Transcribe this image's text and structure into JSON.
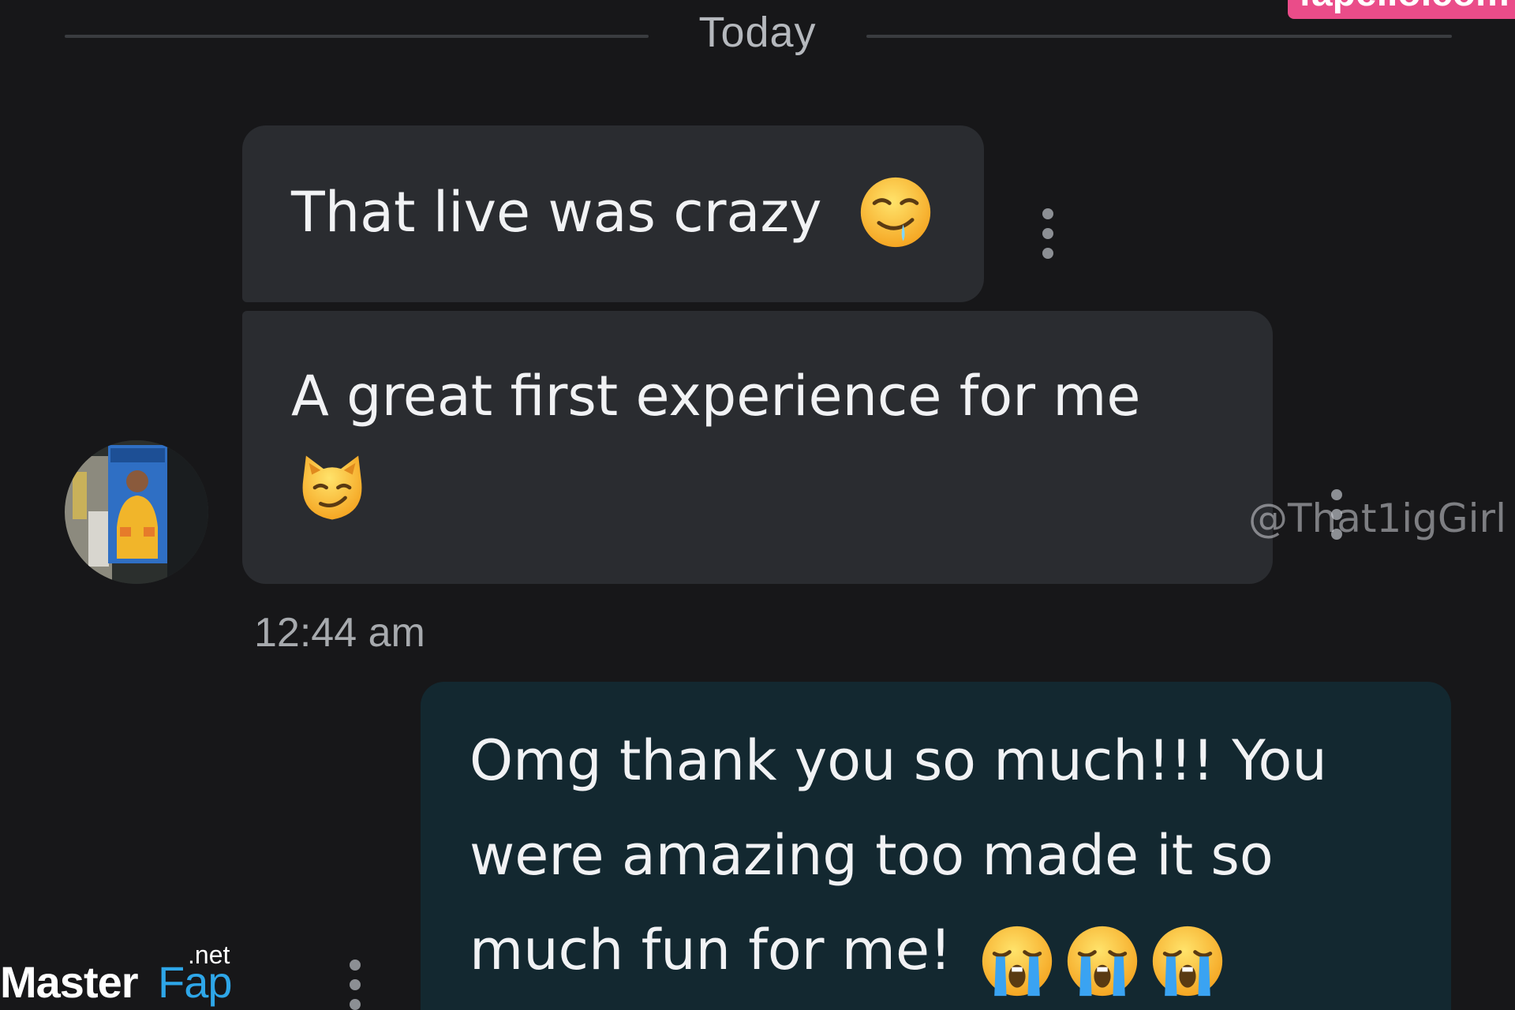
{
  "date_divider": {
    "label": "Today"
  },
  "watermarks": {
    "top_right": "fapello.com",
    "handle": "@That1igGirl",
    "bottom_left_brand": "Master",
    "bottom_left_brand_accent": "Fap",
    "bottom_left_suffix": ".net"
  },
  "messages": [
    {
      "direction": "incoming",
      "text": "That live was crazy",
      "emoji": [
        "drooling-face-icon"
      ]
    },
    {
      "direction": "incoming",
      "text": "A great first experience for me",
      "emoji": [
        "smirking-cat-icon"
      ]
    },
    {
      "direction": "outgoing",
      "lines": [
        "Omg thank you so much!!! You",
        "were amazing too made it so",
        "much fun for me!"
      ],
      "emoji": [
        "loudly-crying-face-icon",
        "loudly-crying-face-icon",
        "loudly-crying-face-icon"
      ]
    }
  ],
  "incoming_timestamp": "12:44 am",
  "colors": {
    "background": "#171719",
    "incoming_bubble": "#2a2c30",
    "outgoing_bubble": "#132830",
    "text": "#f1f2f4",
    "brand_pink": "#ea4c89"
  }
}
